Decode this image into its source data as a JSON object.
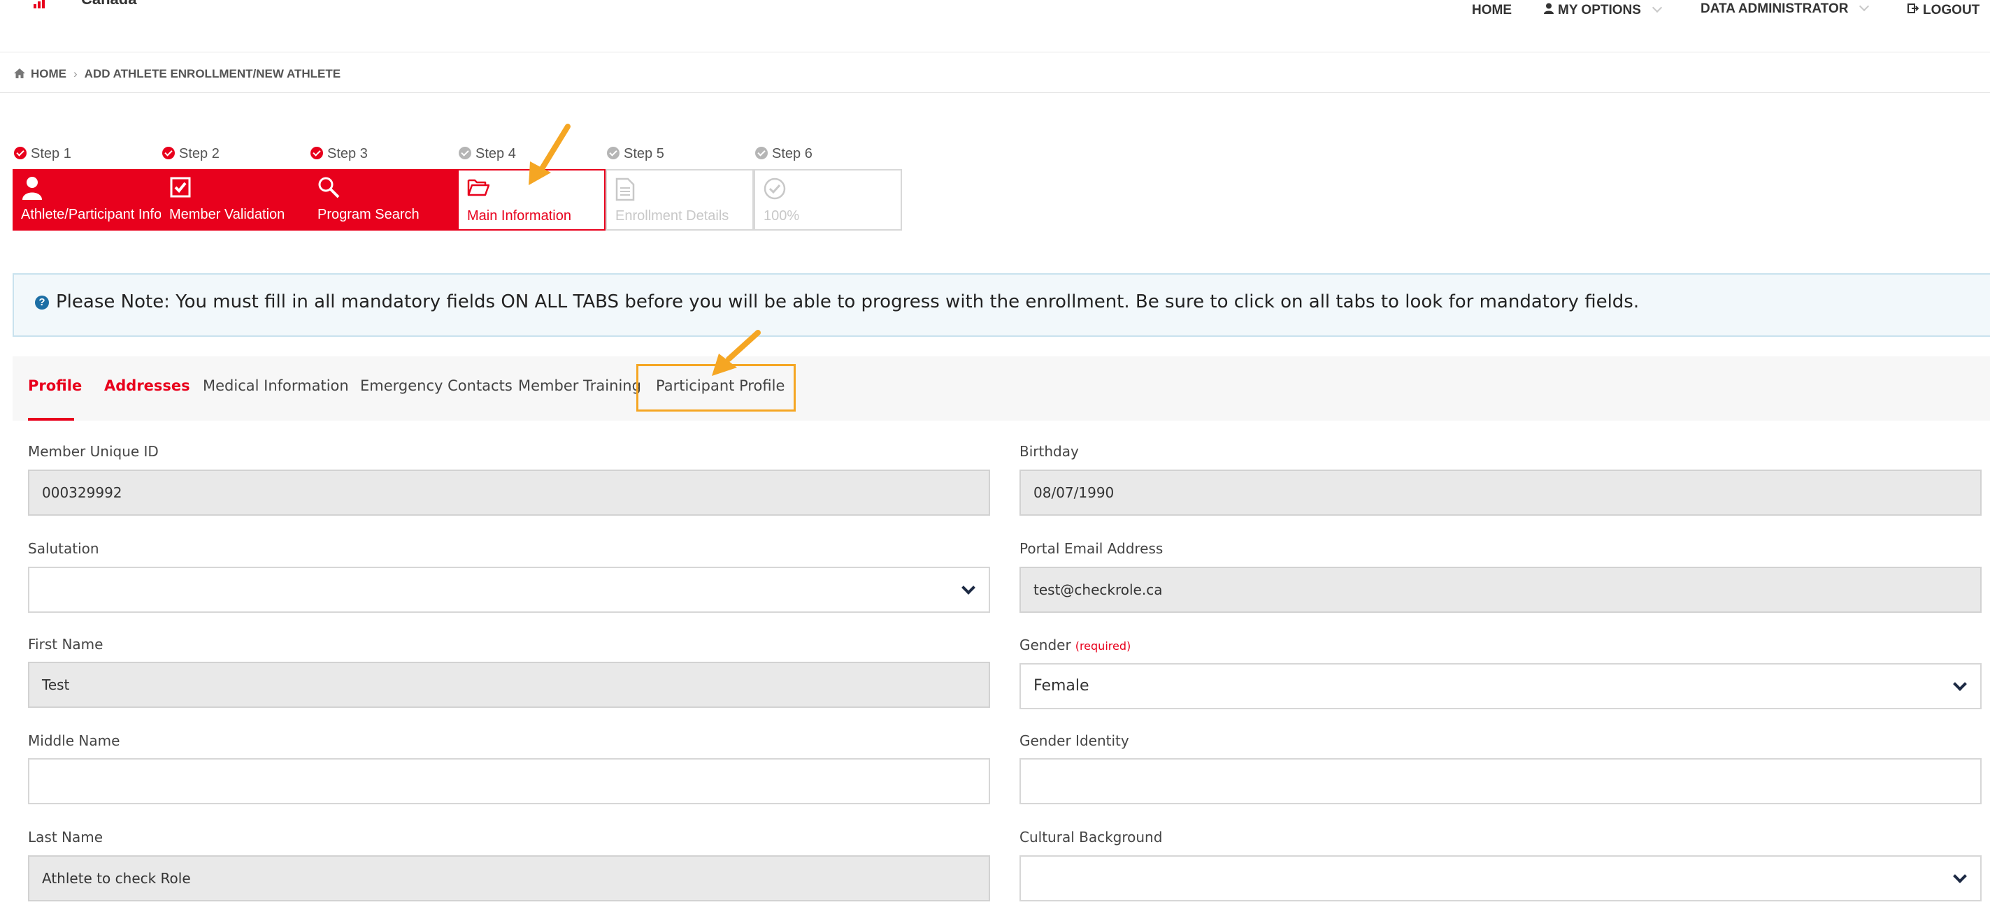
{
  "brand": {
    "logo_text": "Canada"
  },
  "topnav": {
    "home": "HOME",
    "my_options": "MY OPTIONS",
    "role": "DATA ADMINISTRATOR",
    "logout": "LOGOUT"
  },
  "breadcrumb": {
    "home": "HOME",
    "current": "ADD ATHLETE ENROLLMENT/NEW ATHLETE"
  },
  "steps": [
    {
      "label": "Step 1",
      "title": "Athlete/Participant Info",
      "state": "done"
    },
    {
      "label": "Step 2",
      "title": "Member Validation",
      "state": "done"
    },
    {
      "label": "Step 3",
      "title": "Program Search",
      "state": "done"
    },
    {
      "label": "Step 4",
      "title": "Main Information",
      "state": "current"
    },
    {
      "label": "Step 5",
      "title": "Enrollment Details",
      "state": "todo"
    },
    {
      "label": "Step 6",
      "title": "100%",
      "state": "todo"
    }
  ],
  "note": {
    "text": "Please Note: You must fill in all mandatory fields ON ALL TABS before you will be able to progress with the enrollment. Be sure to click on all tabs to look for mandatory fields."
  },
  "tabs": [
    {
      "label": "Profile"
    },
    {
      "label": "Addresses"
    },
    {
      "label": "Medical Information"
    },
    {
      "label": "Emergency Contacts"
    },
    {
      "label": "Member Training"
    },
    {
      "label": "Participant Profile"
    }
  ],
  "form": {
    "member_id": {
      "label": "Member Unique ID",
      "value": "000329992"
    },
    "birthday": {
      "label": "Birthday",
      "value": "08/07/1990"
    },
    "salutation": {
      "label": "Salutation",
      "value": ""
    },
    "portal_email": {
      "label": "Portal Email Address",
      "value": "test@checkrole.ca"
    },
    "first_name": {
      "label": "First Name",
      "value": "Test"
    },
    "gender": {
      "label": "Gender",
      "required": "(required)",
      "value": "Female"
    },
    "middle_name": {
      "label": "Middle Name",
      "value": ""
    },
    "gender_identity": {
      "label": "Gender Identity",
      "value": ""
    },
    "last_name": {
      "label": "Last Name",
      "value": "Athlete to check Role"
    },
    "cultural_background": {
      "label": "Cultural Background",
      "value": ""
    }
  },
  "colors": {
    "accent": "#e8001c",
    "highlight": "#f5a623",
    "note_bg": "#f2f8fb"
  }
}
